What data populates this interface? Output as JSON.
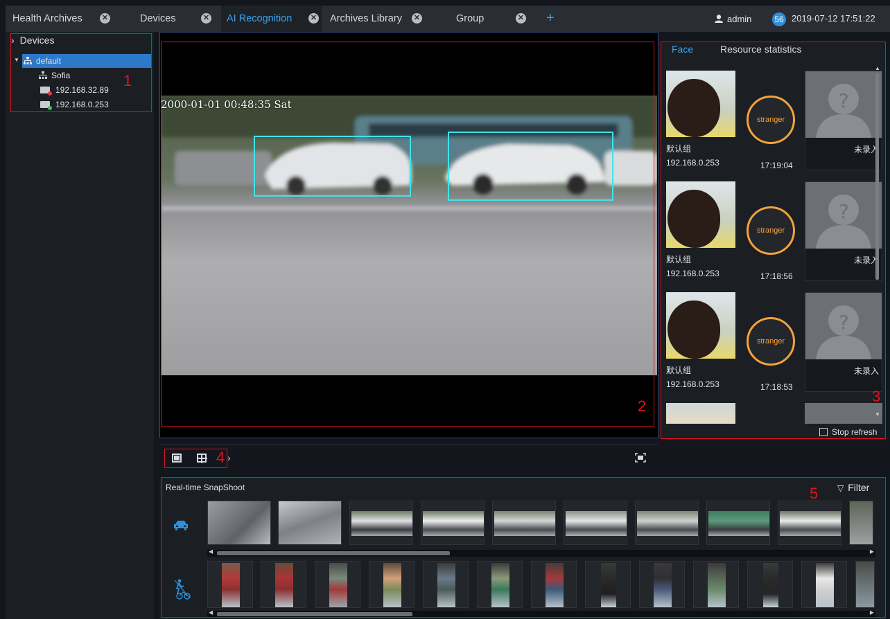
{
  "tabs": [
    {
      "label": "Health Archives",
      "active": false
    },
    {
      "label": "Devices",
      "active": false
    },
    {
      "label": "AI Recognition",
      "active": true
    },
    {
      "label": "Archives Library",
      "active": false
    },
    {
      "label": "Group",
      "active": false
    }
  ],
  "header": {
    "add_icon": "plus-icon",
    "user": "admin",
    "badge": "56",
    "datetime": "2019-07-12 17:51:22"
  },
  "devices": {
    "title": "Devices",
    "root": "default",
    "items": [
      {
        "label": "Sofia",
        "icon": "network-icon"
      },
      {
        "label": "192.168.32.89",
        "icon": "camera-icon"
      },
      {
        "label": "192.168.0.253",
        "icon": "camera-icon"
      }
    ]
  },
  "video": {
    "osd": "2000-01-01 00:48:35 Sat"
  },
  "face_panel": {
    "tabs": [
      "Face",
      "Resource statistics"
    ],
    "records": [
      {
        "group": "默认组",
        "ip": "192.168.0.253",
        "time": "17:19:04",
        "status": "stranger",
        "match": "未录入"
      },
      {
        "group": "默认组",
        "ip": "192.168.0.253",
        "time": "17:18:56",
        "status": "stranger",
        "match": "未录入"
      },
      {
        "group": "默认组",
        "ip": "192.168.0.253",
        "time": "17:18:53",
        "status": "stranger",
        "match": "未录入"
      }
    ],
    "stop_refresh": "Stop refresh"
  },
  "snapshot": {
    "title": "Real-time SnapShoot",
    "filter": "Filter"
  },
  "annotations": [
    "1",
    "2",
    "3",
    "4",
    "5"
  ],
  "colors": {
    "accent": "#3aa3e8",
    "annotation": "#e0141e",
    "stranger": "#f2a33a"
  }
}
